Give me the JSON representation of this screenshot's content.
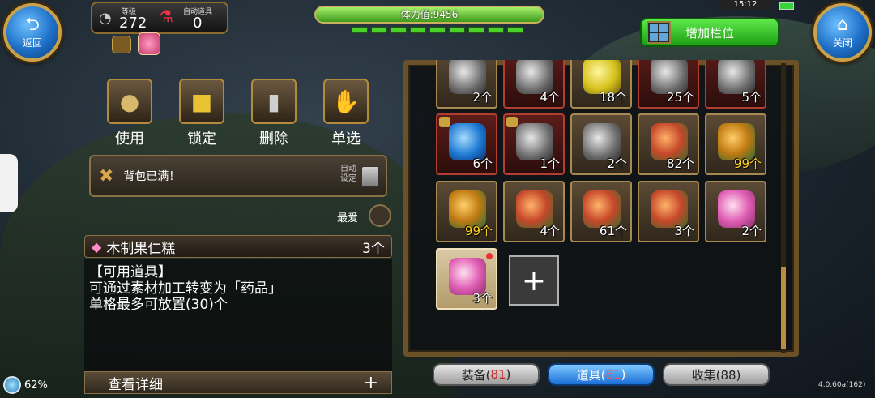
{
  "top_left": {
    "back_label": "返回",
    "level_label": "等级",
    "level_value": "272",
    "auto_label": "自动道具",
    "auto_value": "0"
  },
  "top_center": {
    "stamina_label": "体力值:9456"
  },
  "top_right": {
    "time": "15:12",
    "add_slot_label": "增加栏位",
    "close_label": "关闭"
  },
  "actions": [
    {
      "label": "使用",
      "icon": "pouch-icon"
    },
    {
      "label": "锁定",
      "icon": "padlock-icon"
    },
    {
      "label": "删除",
      "icon": "trash-icon"
    },
    {
      "label": "单选",
      "icon": "hand-pick-icon"
    }
  ],
  "notice": {
    "text": "背包已满！",
    "auto_line1": "自动",
    "auto_line2": "设定"
  },
  "favorite_label": "最爱",
  "item": {
    "name": "木制果仁糕",
    "count": "3个",
    "desc_line1": "【可用道具】",
    "desc_line2": "可通过素材加工转变为「药品」",
    "desc_line3": "单格最多可放置(30)个",
    "detail_label": "查看详细",
    "detail_plus": "+"
  },
  "inventory": [
    {
      "qty": "2个",
      "icon": "grey-gem-icon",
      "style": "normal"
    },
    {
      "qty": "4个",
      "icon": "grey-gem-icon",
      "style": "red"
    },
    {
      "qty": "18个",
      "icon": "yellow-gem-icon",
      "style": "normal"
    },
    {
      "qty": "25个",
      "icon": "grey-gem-icon",
      "style": "red"
    },
    {
      "qty": "5个",
      "icon": "grey-gem-icon",
      "style": "red"
    },
    {
      "qty": "6个",
      "icon": "blue-gem-icon",
      "style": "red",
      "locked": true
    },
    {
      "qty": "1个",
      "icon": "grey-gem-icon",
      "style": "red",
      "locked": true
    },
    {
      "qty": "2个",
      "icon": "grey-gem-icon",
      "style": "normal"
    },
    {
      "qty": "82个",
      "icon": "meat-platter-icon",
      "style": "normal"
    },
    {
      "qty": "99个",
      "icon": "teapot-icon",
      "style": "normal",
      "gold": true
    },
    {
      "qty": "99个",
      "icon": "teapot-icon",
      "style": "normal",
      "gold": true
    },
    {
      "qty": "4个",
      "icon": "meat-platter-icon",
      "style": "normal"
    },
    {
      "qty": "61个",
      "icon": "meat-platter-icon",
      "style": "normal"
    },
    {
      "qty": "3个",
      "icon": "meat-platter-icon",
      "style": "normal"
    },
    {
      "qty": "2个",
      "icon": "cake-icon",
      "style": "normal"
    },
    {
      "qty": "3个",
      "icon": "cake-icon",
      "style": "selected",
      "new": true
    }
  ],
  "tabs": [
    {
      "label": "装备(",
      "num": "81",
      "end": ")"
    },
    {
      "label": "道具(",
      "num": "81",
      "end": ")"
    },
    {
      "label": "收集(88)",
      "num": "",
      "end": ""
    }
  ],
  "footer": {
    "battery": "62%",
    "version": "4.0.60a(162)"
  }
}
